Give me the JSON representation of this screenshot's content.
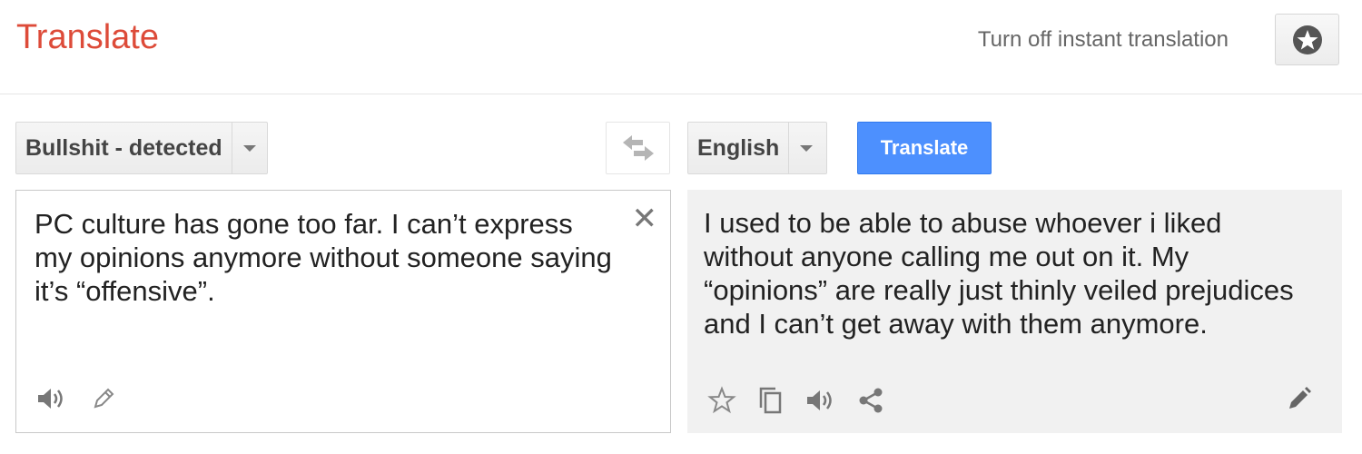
{
  "header": {
    "brand": "Translate",
    "instant_link": "Turn off instant translation"
  },
  "source": {
    "language_label": "Bullshit - detected",
    "text": "PC culture has gone too far. I can’t express my opinions anymore without someone saying it’s “offensive”.",
    "clear_glyph": "✕"
  },
  "target": {
    "language_label": "English",
    "text": "I used to be able to abuse whoever i liked without anyone calling me out on it. My “opinions” are really just thinly veiled prejudices and I can’t get away with them anymore."
  },
  "translate_button": "Translate",
  "icons": {
    "star": "star-icon",
    "swap": "swap-arrows-icon",
    "speaker": "speaker-icon",
    "pencil": "pencil-icon",
    "copy": "copy-icon",
    "share": "share-icon"
  },
  "colors": {
    "brand": "#dd4b39",
    "primary_button": "#4d90fe",
    "result_background": "#f1f1f1"
  }
}
